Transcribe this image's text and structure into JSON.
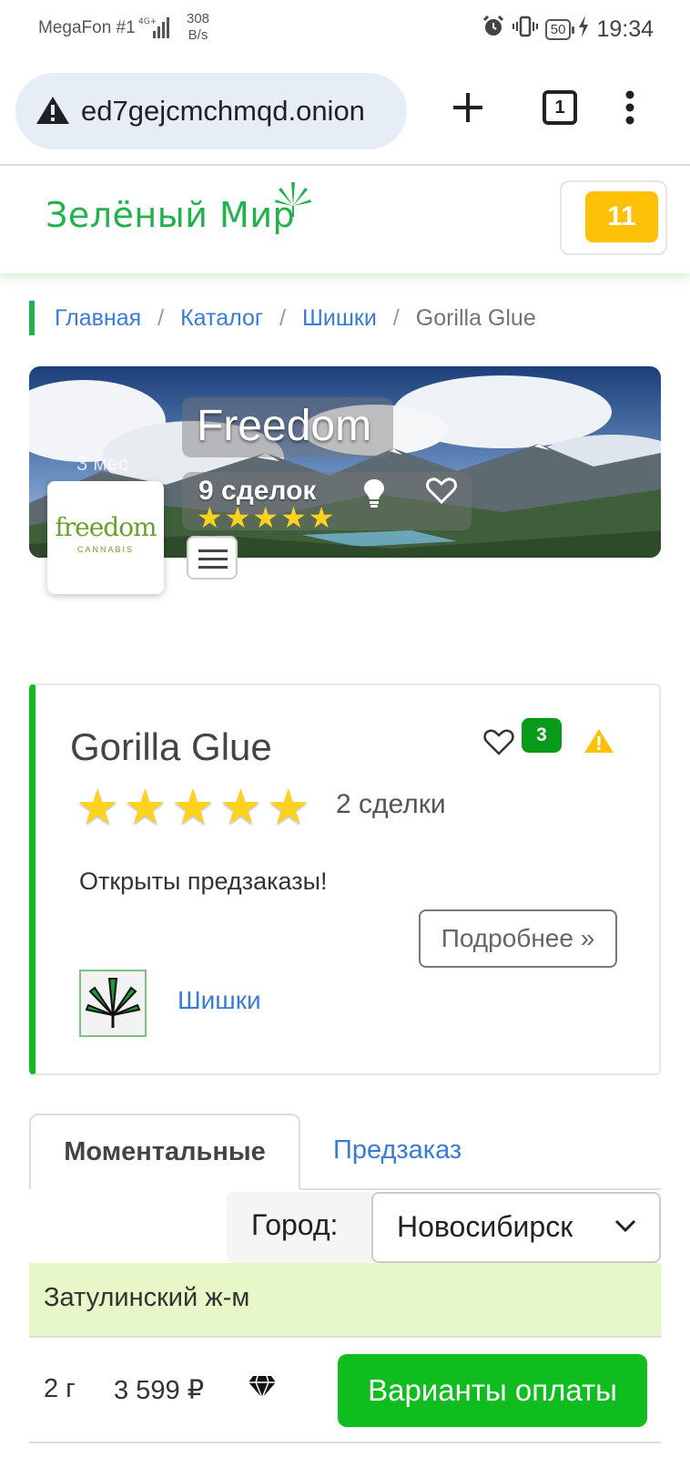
{
  "status_bar": {
    "carrier": "MegaFon #1",
    "network": "4G+",
    "speed_value": "308",
    "speed_unit": "B/s",
    "battery": "50",
    "time": "19:34"
  },
  "browser": {
    "url": "ed7gejcmchmqd.onion",
    "tab_count": "1",
    "icons": [
      "warning-icon",
      "plus-icon",
      "tabs-icon",
      "more-vert-icon"
    ]
  },
  "site": {
    "logo": "Зелёный Мир",
    "cart_count": "11",
    "colors": {
      "brand_green": "#22b14c",
      "button_green": "#0fbd1f",
      "badge_yellow": "#ffc107",
      "link_blue": "#3a7bd5"
    }
  },
  "breadcrumb": {
    "items": [
      "Главная",
      "Каталог",
      "Шишки"
    ],
    "current": "Gorilla Glue",
    "separator": "/"
  },
  "vendor": {
    "since": "3 мес",
    "name": "Freedom",
    "logo_main": "freedom",
    "logo_sub": "CANNABIS",
    "deals": "9 сделок",
    "stars": "★★★★★",
    "rating": 5
  },
  "product": {
    "title": "Gorilla Glue",
    "favorites_count": "3",
    "stars": "★★★★★",
    "rating": 5,
    "deals": "2 сделки",
    "description": "Открыты предзаказы!",
    "more_label": "Подробнее »",
    "category": "Шишки"
  },
  "tabs": {
    "active": "Моментальные",
    "other": "Предзаказ"
  },
  "city": {
    "label": "Город:",
    "selected": "Новосибирск"
  },
  "offers": [
    {
      "district": "Затулинский ж-м",
      "weight": "2 г",
      "price": "3 599 ₽",
      "pay_label": "Варианты оплаты"
    }
  ]
}
